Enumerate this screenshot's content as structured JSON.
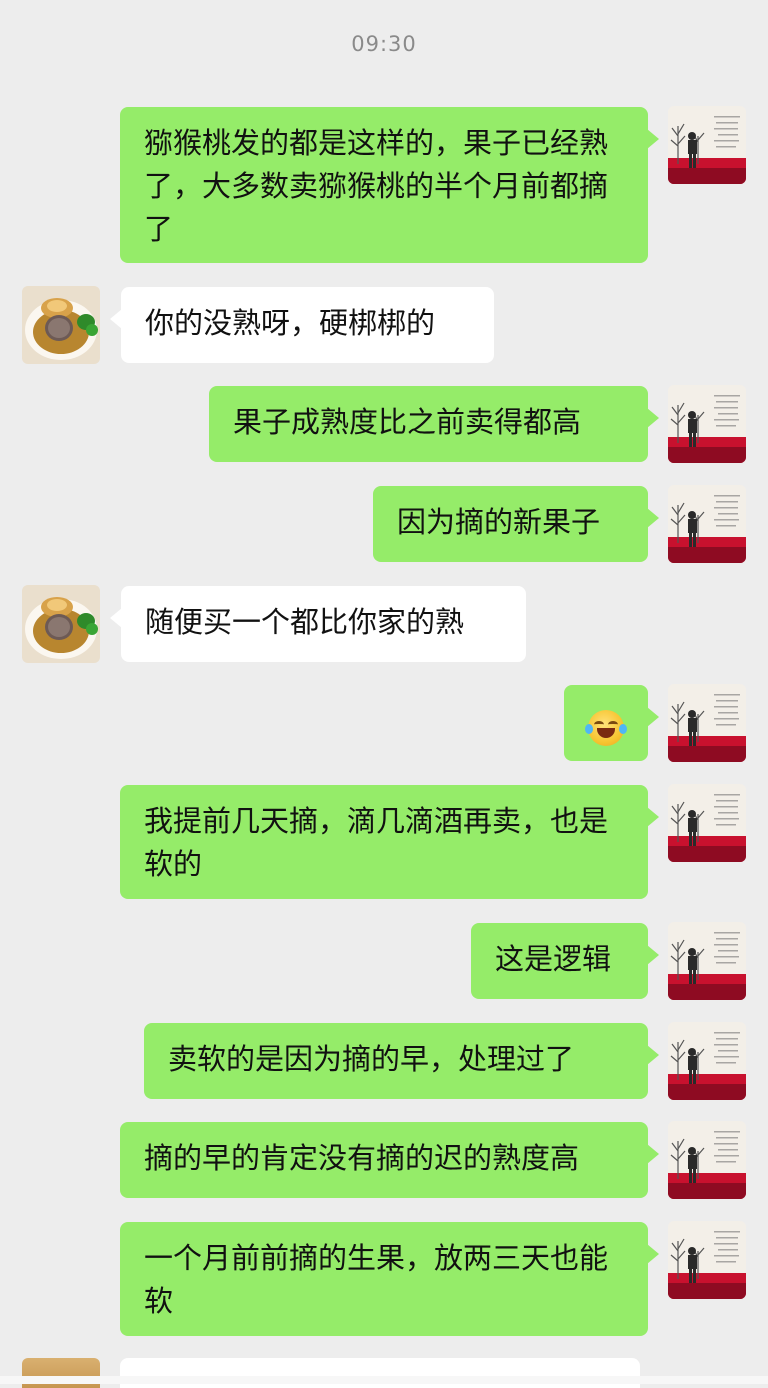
{
  "chat": {
    "timestamp": "09:30",
    "messages": [
      {
        "side": "out",
        "text": "猕猴桃发的都是这样的，果子已经熟了，大多数卖猕猴桃的半个月前都摘了"
      },
      {
        "side": "in",
        "text": "你的没熟呀，硬梆梆的"
      },
      {
        "side": "out",
        "text": "果子成熟度比之前卖得都高"
      },
      {
        "side": "out",
        "text": "因为摘的新果子"
      },
      {
        "side": "in",
        "text": "随便买一个都比你家的熟"
      },
      {
        "side": "out",
        "emoji": "laughing-crying-emoji"
      },
      {
        "side": "out",
        "text": "我提前几天摘，滴几滴酒再卖，也是软的"
      },
      {
        "side": "out",
        "text": "这是逻辑"
      },
      {
        "side": "out",
        "text": "卖软的是因为摘的早，处理过了"
      },
      {
        "side": "out",
        "text": "摘的早的肯定没有摘的迟的熟度高"
      },
      {
        "side": "out",
        "text": "一个月前前摘的生果，放两三天也能软"
      }
    ]
  },
  "colors": {
    "background": "#ededed",
    "outgoing_bubble": "#95ec69",
    "incoming_bubble": "#ffffff",
    "timestamp_text": "#8a8a8a"
  },
  "icons": {
    "self_avatar": "person-silhouette-avatar",
    "other_avatar": "food-plate-avatar",
    "emoji": "laughing-crying-emoji"
  }
}
